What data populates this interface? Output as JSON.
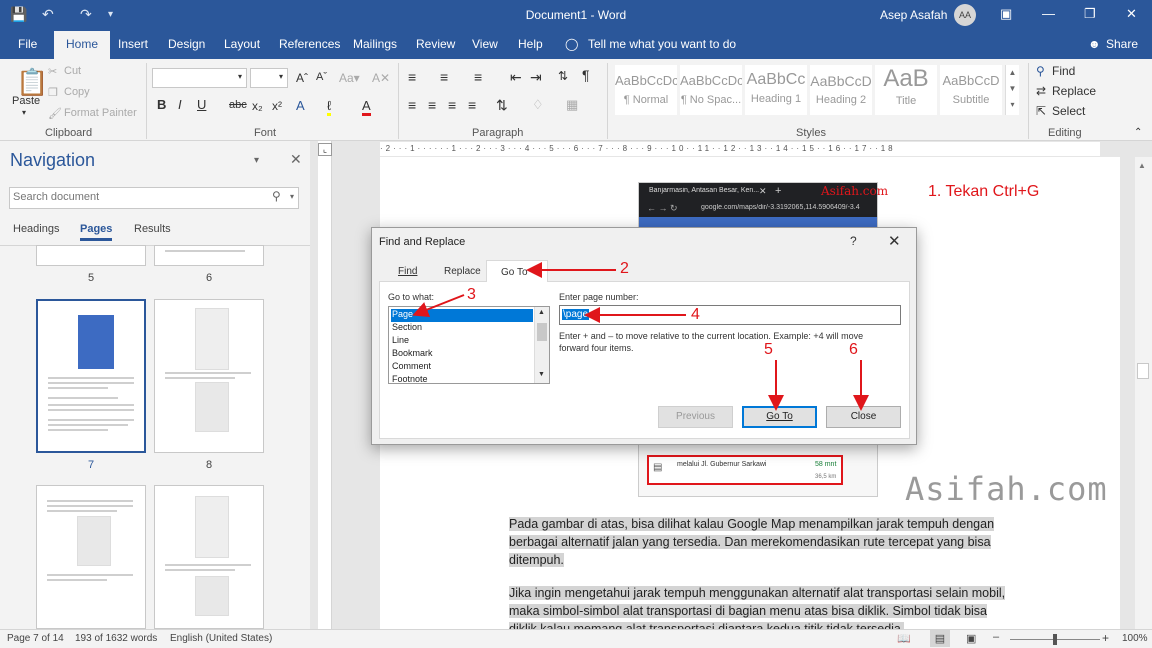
{
  "titlebar": {
    "doc_title": "Document1 - Word",
    "user": "Asep Asafah",
    "avatar": "AA"
  },
  "tabs": [
    "File",
    "Home",
    "Insert",
    "Design",
    "Layout",
    "References",
    "Mailings",
    "Review",
    "View",
    "Help"
  ],
  "tell_me": "Tell me what you want to do",
  "share": "Share",
  "ribbon": {
    "clipboard": {
      "paste": "Paste",
      "cut": "Cut",
      "copy": "Copy",
      "format_painter": "Format Painter",
      "label": "Clipboard"
    },
    "font_label": "Font",
    "paragraph_label": "Paragraph",
    "styles_label": "Styles",
    "styles": [
      {
        "preview": "AaBbCcDc",
        "name": "¶ Normal"
      },
      {
        "preview": "AaBbCcDc",
        "name": "¶ No Spac..."
      },
      {
        "preview": "AaBbCc",
        "name": "Heading 1"
      },
      {
        "preview": "AaBbCcD",
        "name": "Heading 2"
      },
      {
        "preview": "AaB",
        "name": "Title"
      },
      {
        "preview": "AaBbCcD",
        "name": "Subtitle"
      }
    ],
    "editing": {
      "find": "Find",
      "replace": "Replace",
      "select": "Select",
      "label": "Editing"
    }
  },
  "navigation": {
    "title": "Navigation",
    "search_placeholder": "Search document",
    "tabs": [
      "Headings",
      "Pages",
      "Results"
    ],
    "pages": [
      "5",
      "6",
      "7",
      "8"
    ]
  },
  "dialog": {
    "title": "Find and Replace",
    "help": "?",
    "tabs": [
      "Find",
      "Replace",
      "Go To"
    ],
    "goto_label": "Go to what:",
    "goto_items": [
      "Page",
      "Section",
      "Line",
      "Bookmark",
      "Comment",
      "Footnote"
    ],
    "page_number_label": "Enter page number:",
    "page_number_value": "\\page",
    "hint": "Enter + and – to move relative to the current location. Example: +4 will move forward four items.",
    "buttons": {
      "previous": "Previous",
      "goto": "Go To",
      "close": "Close"
    }
  },
  "annotations": {
    "step1": "1. Tekan Ctrl+G",
    "n2": "2",
    "n3": "3",
    "n4": "4",
    "n5": "5",
    "n6": "6"
  },
  "embedded": {
    "tab_title": "Banjarmasin, Antasan Besar, Ken...",
    "url": "google.com/maps/dir/-3.3192065,114.5906409/-3.4",
    "route": "melalui Jl. Gubernur Sarkawi",
    "time": "58 mnt",
    "distance": "36,5 km",
    "brand": "Asifah.com"
  },
  "watermark": "Asifah.com",
  "document": {
    "para1": "Pada gambar di atas, bisa dilihat kalau Google Map menampilkan jarak tempuh dengan berbagai alternatif jalan yang tersedia. Dan merekomendasikan rute tercepat yang bisa ditempuh.",
    "para2": "Jika ingin mengetahui jarak tempuh menggunakan alternatif alat transportasi selain mobil, maka simbol-simbol alat transportasi di bagian menu atas bisa diklik. Simbol tidak bisa diklik kalau memang alat transportasi diantara kedua titik tidak tersedia."
  },
  "status": {
    "page": "Page 7 of 14",
    "words": "193 of 1632 words",
    "language": "English (United States)",
    "zoom": "100%"
  }
}
